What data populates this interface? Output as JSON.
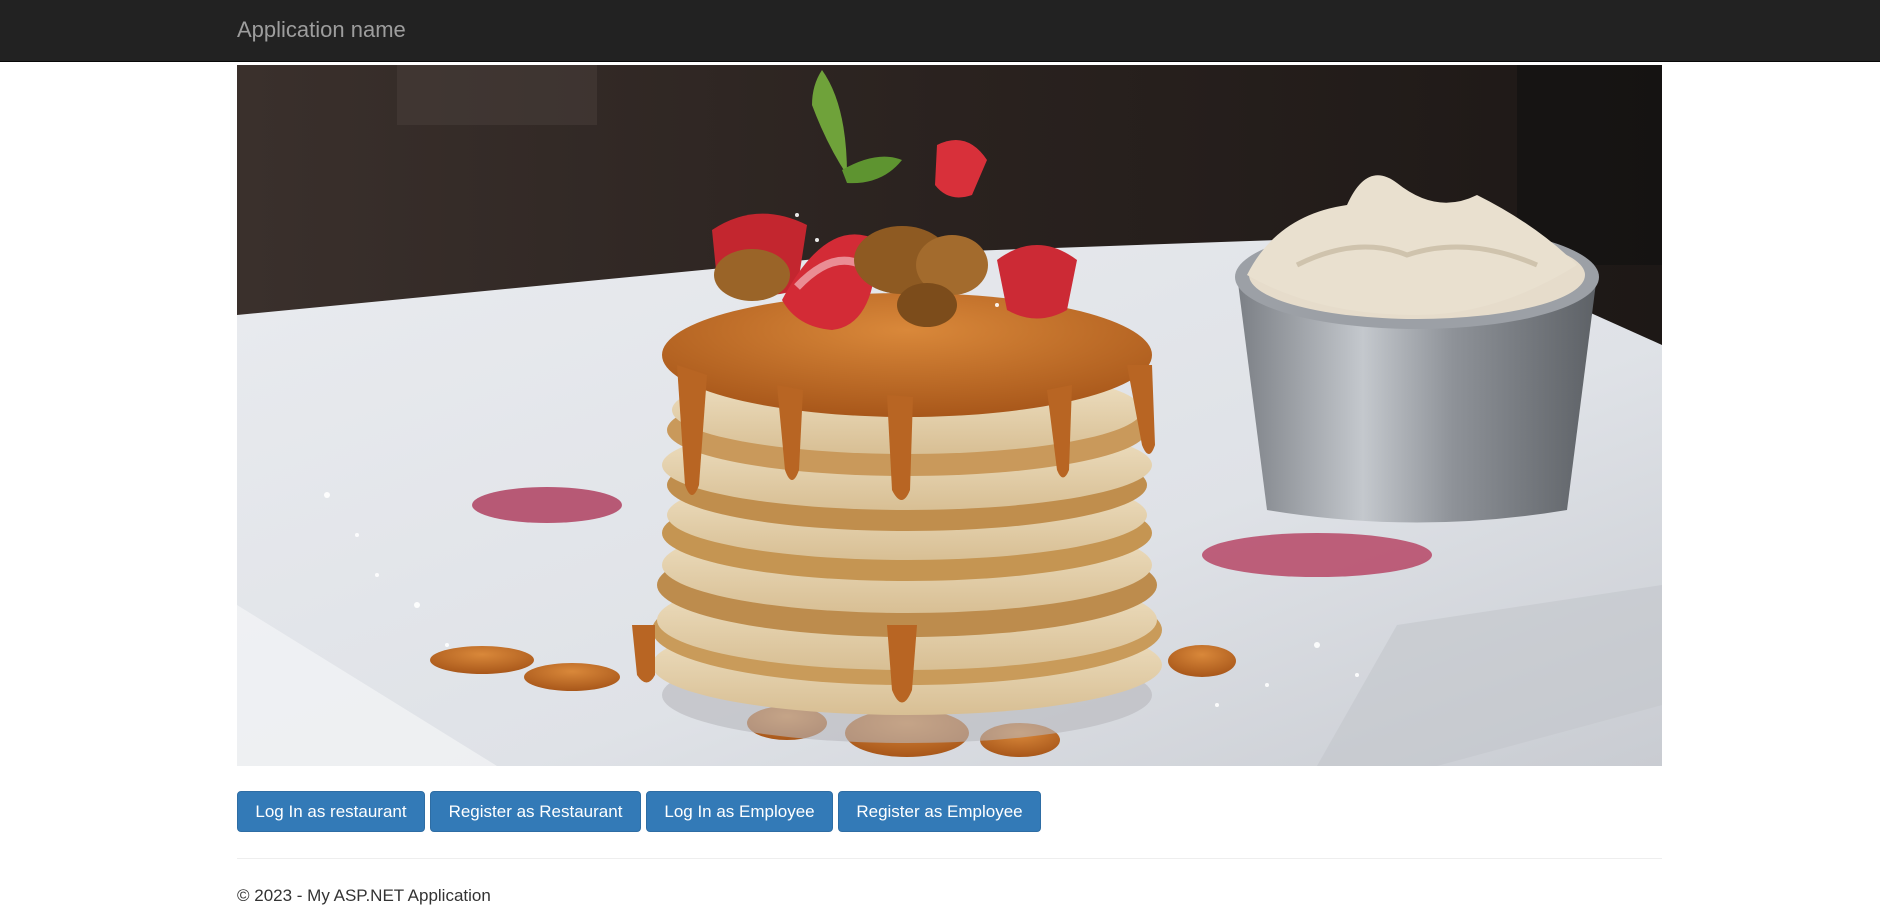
{
  "navbar": {
    "brand": "Application name"
  },
  "hero": {
    "image": "pancake-stack-photo"
  },
  "actions": [
    {
      "label": "Log In as restaurant"
    },
    {
      "label": "Register as Restaurant"
    },
    {
      "label": "Log In as Employee"
    },
    {
      "label": "Register as Employee"
    }
  ],
  "footer": {
    "text": "© 2023 - My ASP.NET Application"
  },
  "colors": {
    "navbar_bg": "#222222",
    "brand_text": "#9d9d9d",
    "button_primary": "#337ab7",
    "button_border": "#2e6da4",
    "footer_text": "#333333"
  }
}
